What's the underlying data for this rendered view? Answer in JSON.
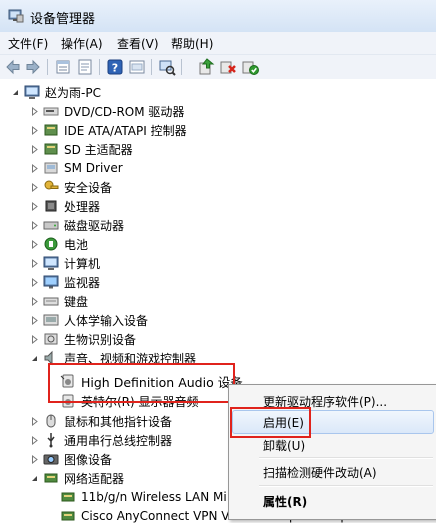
{
  "window": {
    "title": "设备管理器"
  },
  "menu": [
    "文件(F)",
    "操作(A)",
    "查看(V)",
    "帮助(H)"
  ],
  "toolbar_icons": [
    "back-icon",
    "forward-icon",
    "sep",
    "view-icon",
    "properties-icon",
    "sep",
    "help-icon",
    "show-hidden-icon",
    "sep",
    "scan-icon",
    "sep",
    "update-driver-icon",
    "uninstall-icon",
    "enable-icon"
  ],
  "tree": {
    "root": "赵为雨-PC",
    "nodes": [
      {
        "label": "DVD/CD-ROM 驱动器",
        "icon": "dvd-icon"
      },
      {
        "label": "IDE ATA/ATAPI 控制器",
        "icon": "ide-icon"
      },
      {
        "label": "SD 主适配器",
        "icon": "sd-icon"
      },
      {
        "label": "SM Driver",
        "icon": "sm-driver-icon"
      },
      {
        "label": "安全设备",
        "icon": "security-icon"
      },
      {
        "label": "处理器",
        "icon": "cpu-icon"
      },
      {
        "label": "磁盘驱动器",
        "icon": "disk-icon"
      },
      {
        "label": "电池",
        "icon": "battery-icon"
      },
      {
        "label": "计算机",
        "icon": "computer-icon"
      },
      {
        "label": "监视器",
        "icon": "monitor-icon"
      },
      {
        "label": "键盘",
        "icon": "keyboard-icon"
      },
      {
        "label": "人体学输入设备",
        "icon": "hid-icon"
      },
      {
        "label": "生物识别设备",
        "icon": "biometric-icon"
      },
      {
        "label": "声音、视频和游戏控制器",
        "icon": "sound-icon",
        "expanded": true
      },
      {
        "label": "High Definition Audio 设备",
        "icon": "audio-device-icon",
        "child": true
      },
      {
        "label": "英特尔(R) 显示器音频",
        "icon": "audio-device-icon",
        "child": true
      },
      {
        "label": "鼠标和其他指针设备",
        "icon": "mouse-icon"
      },
      {
        "label": "通用串行总线控制器",
        "icon": "usb-icon"
      },
      {
        "label": "图像设备",
        "icon": "camera-icon"
      },
      {
        "label": "网络适配器",
        "icon": "network-icon",
        "expanded": true
      },
      {
        "label": "11b/g/n  Wireless LAN Mi",
        "icon": "nic-icon",
        "child": true
      },
      {
        "label": "Cisco AnyConnect VPN Virtual Miniport Adapter for Windows",
        "icon": "nic-icon",
        "child": true
      }
    ]
  },
  "context_menu": {
    "items": [
      "更新驱动程序软件(P)...",
      "启用(E)",
      "卸载(U)",
      "扫描检测硬件改动(A)",
      "属性(R)"
    ]
  },
  "colors": {
    "highlight_border": "#e0231c",
    "hover_border": "#a9c6ed"
  }
}
